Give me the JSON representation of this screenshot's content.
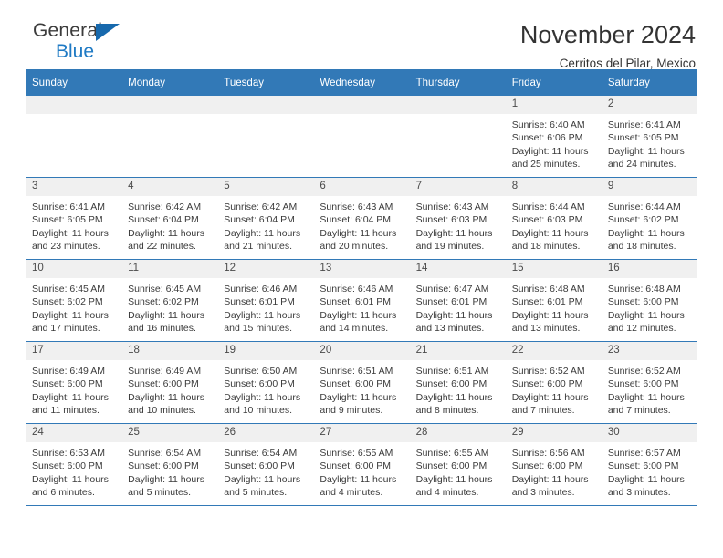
{
  "brand": {
    "name_top": "General",
    "name_bottom": "Blue"
  },
  "header": {
    "title": "November 2024",
    "subtitle": "Cerritos del Pilar, Mexico"
  },
  "colors": {
    "header_blue": "#3279b7",
    "brand_blue": "#1f7ac4",
    "daynum_band": "#f0f0f0"
  },
  "weekdays": [
    "Sunday",
    "Monday",
    "Tuesday",
    "Wednesday",
    "Thursday",
    "Friday",
    "Saturday"
  ],
  "labels": {
    "sunrise_prefix": "Sunrise:",
    "sunset_prefix": "Sunset:",
    "daylight_prefix": "Daylight:"
  },
  "weeks": [
    [
      {
        "day": "",
        "empty": true
      },
      {
        "day": "",
        "empty": true
      },
      {
        "day": "",
        "empty": true
      },
      {
        "day": "",
        "empty": true
      },
      {
        "day": "",
        "empty": true
      },
      {
        "day": "1",
        "sunrise": "Sunrise: 6:40 AM",
        "sunset": "Sunset: 6:06 PM",
        "daylight": "Daylight: 11 hours and 25 minutes."
      },
      {
        "day": "2",
        "sunrise": "Sunrise: 6:41 AM",
        "sunset": "Sunset: 6:05 PM",
        "daylight": "Daylight: 11 hours and 24 minutes."
      }
    ],
    [
      {
        "day": "3",
        "sunrise": "Sunrise: 6:41 AM",
        "sunset": "Sunset: 6:05 PM",
        "daylight": "Daylight: 11 hours and 23 minutes."
      },
      {
        "day": "4",
        "sunrise": "Sunrise: 6:42 AM",
        "sunset": "Sunset: 6:04 PM",
        "daylight": "Daylight: 11 hours and 22 minutes."
      },
      {
        "day": "5",
        "sunrise": "Sunrise: 6:42 AM",
        "sunset": "Sunset: 6:04 PM",
        "daylight": "Daylight: 11 hours and 21 minutes."
      },
      {
        "day": "6",
        "sunrise": "Sunrise: 6:43 AM",
        "sunset": "Sunset: 6:04 PM",
        "daylight": "Daylight: 11 hours and 20 minutes."
      },
      {
        "day": "7",
        "sunrise": "Sunrise: 6:43 AM",
        "sunset": "Sunset: 6:03 PM",
        "daylight": "Daylight: 11 hours and 19 minutes."
      },
      {
        "day": "8",
        "sunrise": "Sunrise: 6:44 AM",
        "sunset": "Sunset: 6:03 PM",
        "daylight": "Daylight: 11 hours and 18 minutes."
      },
      {
        "day": "9",
        "sunrise": "Sunrise: 6:44 AM",
        "sunset": "Sunset: 6:02 PM",
        "daylight": "Daylight: 11 hours and 18 minutes."
      }
    ],
    [
      {
        "day": "10",
        "sunrise": "Sunrise: 6:45 AM",
        "sunset": "Sunset: 6:02 PM",
        "daylight": "Daylight: 11 hours and 17 minutes."
      },
      {
        "day": "11",
        "sunrise": "Sunrise: 6:45 AM",
        "sunset": "Sunset: 6:02 PM",
        "daylight": "Daylight: 11 hours and 16 minutes."
      },
      {
        "day": "12",
        "sunrise": "Sunrise: 6:46 AM",
        "sunset": "Sunset: 6:01 PM",
        "daylight": "Daylight: 11 hours and 15 minutes."
      },
      {
        "day": "13",
        "sunrise": "Sunrise: 6:46 AM",
        "sunset": "Sunset: 6:01 PM",
        "daylight": "Daylight: 11 hours and 14 minutes."
      },
      {
        "day": "14",
        "sunrise": "Sunrise: 6:47 AM",
        "sunset": "Sunset: 6:01 PM",
        "daylight": "Daylight: 11 hours and 13 minutes."
      },
      {
        "day": "15",
        "sunrise": "Sunrise: 6:48 AM",
        "sunset": "Sunset: 6:01 PM",
        "daylight": "Daylight: 11 hours and 13 minutes."
      },
      {
        "day": "16",
        "sunrise": "Sunrise: 6:48 AM",
        "sunset": "Sunset: 6:00 PM",
        "daylight": "Daylight: 11 hours and 12 minutes."
      }
    ],
    [
      {
        "day": "17",
        "sunrise": "Sunrise: 6:49 AM",
        "sunset": "Sunset: 6:00 PM",
        "daylight": "Daylight: 11 hours and 11 minutes."
      },
      {
        "day": "18",
        "sunrise": "Sunrise: 6:49 AM",
        "sunset": "Sunset: 6:00 PM",
        "daylight": "Daylight: 11 hours and 10 minutes."
      },
      {
        "day": "19",
        "sunrise": "Sunrise: 6:50 AM",
        "sunset": "Sunset: 6:00 PM",
        "daylight": "Daylight: 11 hours and 10 minutes."
      },
      {
        "day": "20",
        "sunrise": "Sunrise: 6:51 AM",
        "sunset": "Sunset: 6:00 PM",
        "daylight": "Daylight: 11 hours and 9 minutes."
      },
      {
        "day": "21",
        "sunrise": "Sunrise: 6:51 AM",
        "sunset": "Sunset: 6:00 PM",
        "daylight": "Daylight: 11 hours and 8 minutes."
      },
      {
        "day": "22",
        "sunrise": "Sunrise: 6:52 AM",
        "sunset": "Sunset: 6:00 PM",
        "daylight": "Daylight: 11 hours and 7 minutes."
      },
      {
        "day": "23",
        "sunrise": "Sunrise: 6:52 AM",
        "sunset": "Sunset: 6:00 PM",
        "daylight": "Daylight: 11 hours and 7 minutes."
      }
    ],
    [
      {
        "day": "24",
        "sunrise": "Sunrise: 6:53 AM",
        "sunset": "Sunset: 6:00 PM",
        "daylight": "Daylight: 11 hours and 6 minutes."
      },
      {
        "day": "25",
        "sunrise": "Sunrise: 6:54 AM",
        "sunset": "Sunset: 6:00 PM",
        "daylight": "Daylight: 11 hours and 5 minutes."
      },
      {
        "day": "26",
        "sunrise": "Sunrise: 6:54 AM",
        "sunset": "Sunset: 6:00 PM",
        "daylight": "Daylight: 11 hours and 5 minutes."
      },
      {
        "day": "27",
        "sunrise": "Sunrise: 6:55 AM",
        "sunset": "Sunset: 6:00 PM",
        "daylight": "Daylight: 11 hours and 4 minutes."
      },
      {
        "day": "28",
        "sunrise": "Sunrise: 6:55 AM",
        "sunset": "Sunset: 6:00 PM",
        "daylight": "Daylight: 11 hours and 4 minutes."
      },
      {
        "day": "29",
        "sunrise": "Sunrise: 6:56 AM",
        "sunset": "Sunset: 6:00 PM",
        "daylight": "Daylight: 11 hours and 3 minutes."
      },
      {
        "day": "30",
        "sunrise": "Sunrise: 6:57 AM",
        "sunset": "Sunset: 6:00 PM",
        "daylight": "Daylight: 11 hours and 3 minutes."
      }
    ]
  ]
}
